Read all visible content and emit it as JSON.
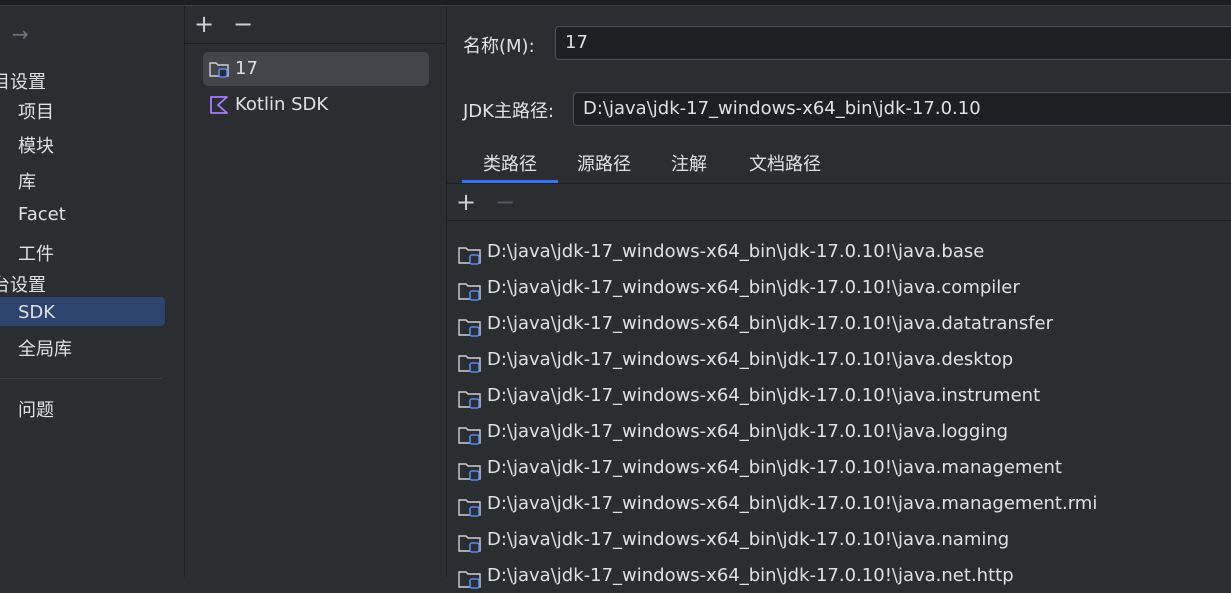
{
  "nav": {
    "sections": [
      {
        "label": "目设置"
      },
      {
        "label": "台设置"
      }
    ],
    "items": [
      {
        "label": "项目"
      },
      {
        "label": "模块"
      },
      {
        "label": "库"
      },
      {
        "label": "Facet"
      },
      {
        "label": "工件"
      },
      {
        "label": "SDK"
      },
      {
        "label": "全局库"
      },
      {
        "label": "问题"
      }
    ],
    "selected": "SDK"
  },
  "sdk_list": {
    "items": [
      {
        "label": "17",
        "icon": "jdk-folder-icon",
        "selected": true
      },
      {
        "label": "Kotlin SDK",
        "icon": "kotlin-icon",
        "selected": false
      }
    ]
  },
  "detail": {
    "name_label": "名称(M):",
    "name_value": "17",
    "home_label": "JDK主路径:",
    "home_value": "D:\\java\\jdk-17_windows-x64_bin\\jdk-17.0.10",
    "tabs": [
      "类路径",
      "源路径",
      "注解",
      "文档路径"
    ],
    "active_tab": "类路径",
    "classpath": [
      "D:\\java\\jdk-17_windows-x64_bin\\jdk-17.0.10!\\java.base",
      "D:\\java\\jdk-17_windows-x64_bin\\jdk-17.0.10!\\java.compiler",
      "D:\\java\\jdk-17_windows-x64_bin\\jdk-17.0.10!\\java.datatransfer",
      "D:\\java\\jdk-17_windows-x64_bin\\jdk-17.0.10!\\java.desktop",
      "D:\\java\\jdk-17_windows-x64_bin\\jdk-17.0.10!\\java.instrument",
      "D:\\java\\jdk-17_windows-x64_bin\\jdk-17.0.10!\\java.logging",
      "D:\\java\\jdk-17_windows-x64_bin\\jdk-17.0.10!\\java.management",
      "D:\\java\\jdk-17_windows-x64_bin\\jdk-17.0.10!\\java.management.rmi",
      "D:\\java\\jdk-17_windows-x64_bin\\jdk-17.0.10!\\java.naming",
      "D:\\java\\jdk-17_windows-x64_bin\\jdk-17.0.10!\\java.net.http"
    ]
  },
  "colors": {
    "background": "#2b2d30",
    "selection": "#2e436e",
    "accent": "#3574f0",
    "kotlin": "#a97bff",
    "jdk_badge": "#548af7"
  }
}
